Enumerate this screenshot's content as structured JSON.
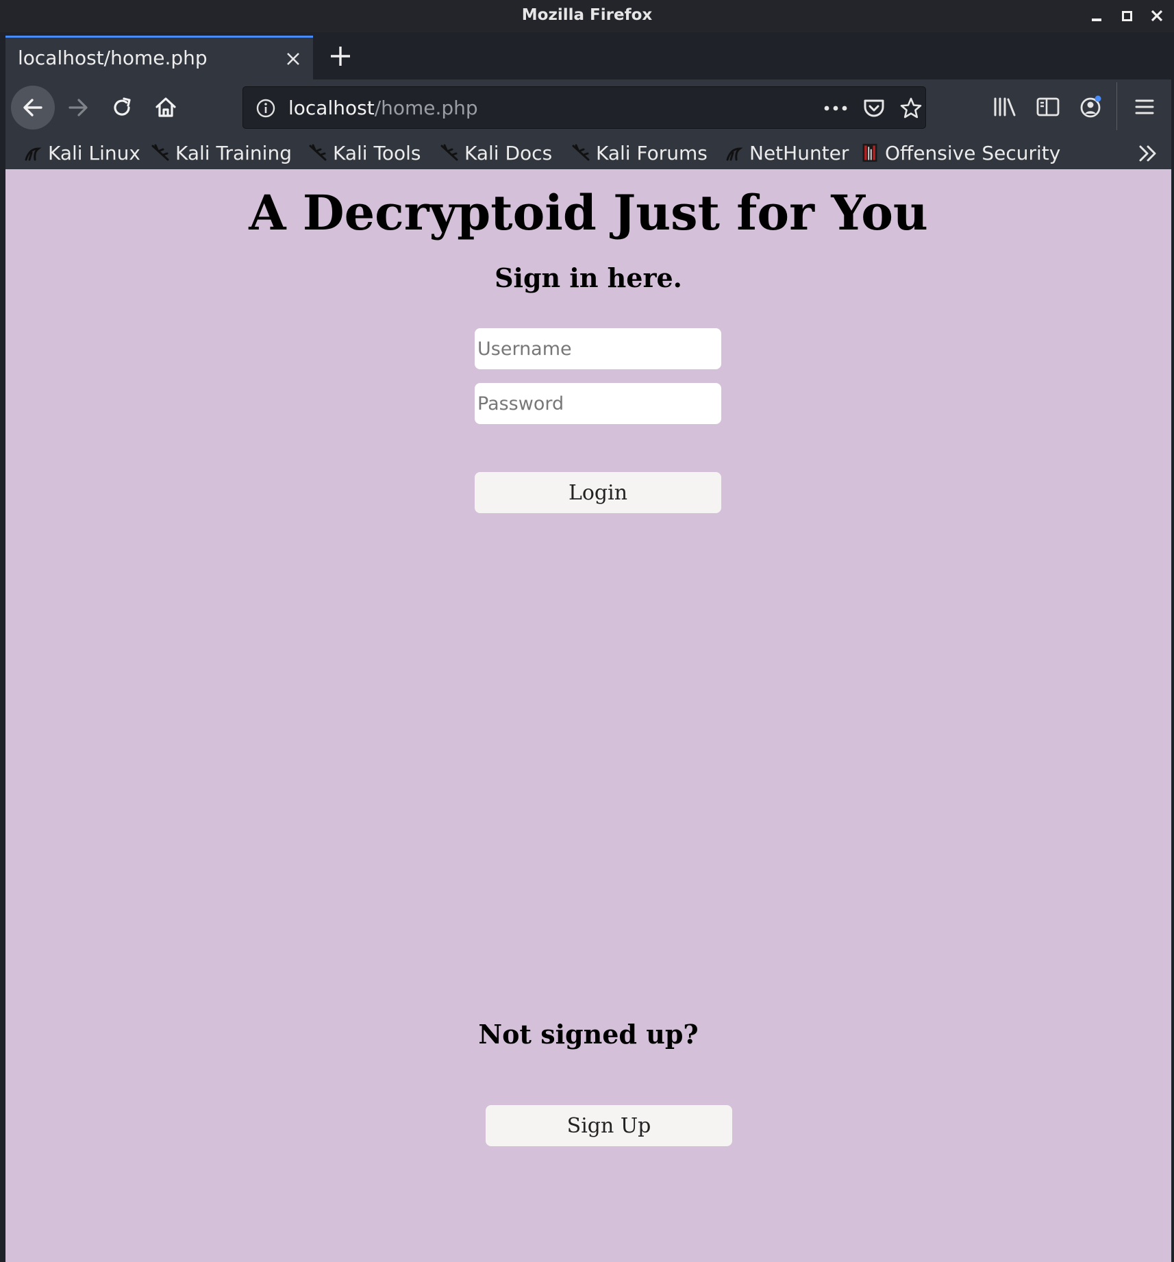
{
  "window": {
    "title": "Mozilla Firefox"
  },
  "tabs": [
    {
      "label": "localhost/home.php"
    }
  ],
  "urlbar": {
    "host": "localhost",
    "path": "/home.php"
  },
  "bookmarks": [
    {
      "label": "Kali Linux",
      "icon": "kali-dragon-icon"
    },
    {
      "label": "Kali Training",
      "icon": "kali-dragon-icon"
    },
    {
      "label": "Kali Tools",
      "icon": "kali-dragon-icon"
    },
    {
      "label": "Kali Docs",
      "icon": "kali-dragon-icon"
    },
    {
      "label": "Kali Forums",
      "icon": "kali-dragon-icon"
    },
    {
      "label": "NetHunter",
      "icon": "kali-dragon-icon"
    },
    {
      "label": "Offensive Security",
      "icon": "offsec-icon"
    }
  ],
  "page": {
    "title": "A Decryptoid Just for You",
    "signin_heading": "Sign in here.",
    "username_placeholder": "Username",
    "password_placeholder": "Password",
    "login_label": "Login",
    "not_signed_heading": "Not signed up?",
    "signup_label": "Sign Up",
    "background_color": "#d4c0d8"
  },
  "colors": {
    "tab_accent": "#4a8cf5",
    "toolbar_bg": "#32363f",
    "titlebar_bg": "#23252b"
  }
}
